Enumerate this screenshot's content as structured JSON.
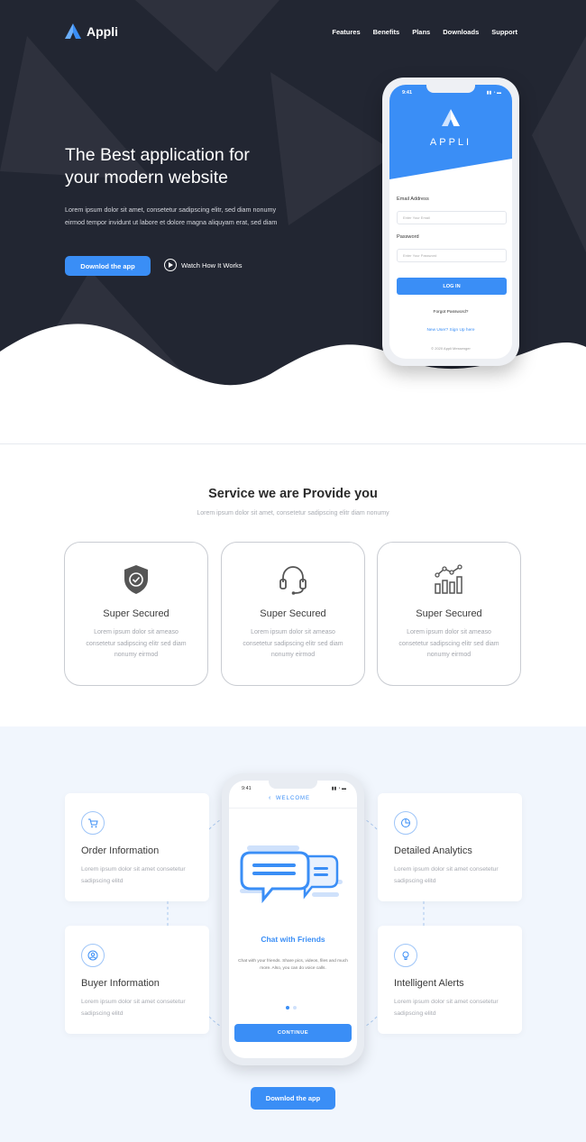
{
  "brand": {
    "name": "Appli"
  },
  "nav": {
    "items": [
      "Features",
      "Benefits",
      "Plans",
      "Downloads",
      "Support"
    ]
  },
  "hero": {
    "title_line1": "The Best application for",
    "title_line2": "your modern website",
    "description": "Lorem ipsum dolor sit amet, consetetur sadipscing elitr, sed diam nonumy eirmod tempor invidunt ut labore et dolore magna aliquyam erat, sed diam",
    "download_button": "Downlod the app",
    "watch_link": "Watch How It Works"
  },
  "login_phone": {
    "time": "9:41",
    "brand": "APPLI",
    "email_label": "Email Address",
    "email_placeholder": "Enter Your Email",
    "password_label": "Password",
    "password_placeholder": "Enter Your Password",
    "login_button": "LOG IN",
    "forgot": "Forgot Password?",
    "signup": "New User? Sign Up here",
    "copyright": "© 2020 Appli Messenger"
  },
  "services": {
    "title": "Service we are Provide you",
    "subtitle": "Lorem ipsum dolor sit amet, consetetur sadipscing elitr diam nonumy",
    "cards": [
      {
        "icon": "shield-check-icon",
        "title": "Super Secured",
        "desc": "Lorem ipsum dolor sit ameaso consetetur sadipscing elitr sed diam nonumy eirmod"
      },
      {
        "icon": "headset-icon",
        "title": "Super Secured",
        "desc": "Lorem ipsum dolor sit ameaso consetetur sadipscing elitr sed diam nonumy eirmod"
      },
      {
        "icon": "bar-chart-icon",
        "title": "Super Secured",
        "desc": "Lorem ipsum dolor sit ameaso consetetur sadipscing elitr sed diam nonumy eirmod"
      }
    ]
  },
  "features": {
    "cards": [
      {
        "icon": "cart-icon",
        "title": "Order Information",
        "desc": "Lorem ipsum dolor sit amet consetetur sadipscing elitd"
      },
      {
        "icon": "analytics-icon",
        "title": "Detailed Analytics",
        "desc": "Lorem ipsum dolor sit amet consetetur sadipscing elitd"
      },
      {
        "icon": "user-icon",
        "title": "Buyer Information",
        "desc": "Lorem ipsum dolor sit amet consetetur sadipscing elitd"
      },
      {
        "icon": "bulb-icon",
        "title": "Intelligent Alerts",
        "desc": "Lorem ipsum dolor sit amet consetetur sadipscing elitd"
      }
    ],
    "download_button": "Downlod the app"
  },
  "chat_phone": {
    "time": "9:41",
    "header": "WELCOME",
    "title": "Chat with Friends",
    "desc": "Chat with your friends. Share pics, videos, files and much more. Also, you can do voice calls.",
    "continue_button": "CONTINUE"
  },
  "colors": {
    "accent": "#3a8ef6",
    "hero_bg": "#222632",
    "feature_bg": "#f1f6fd"
  }
}
